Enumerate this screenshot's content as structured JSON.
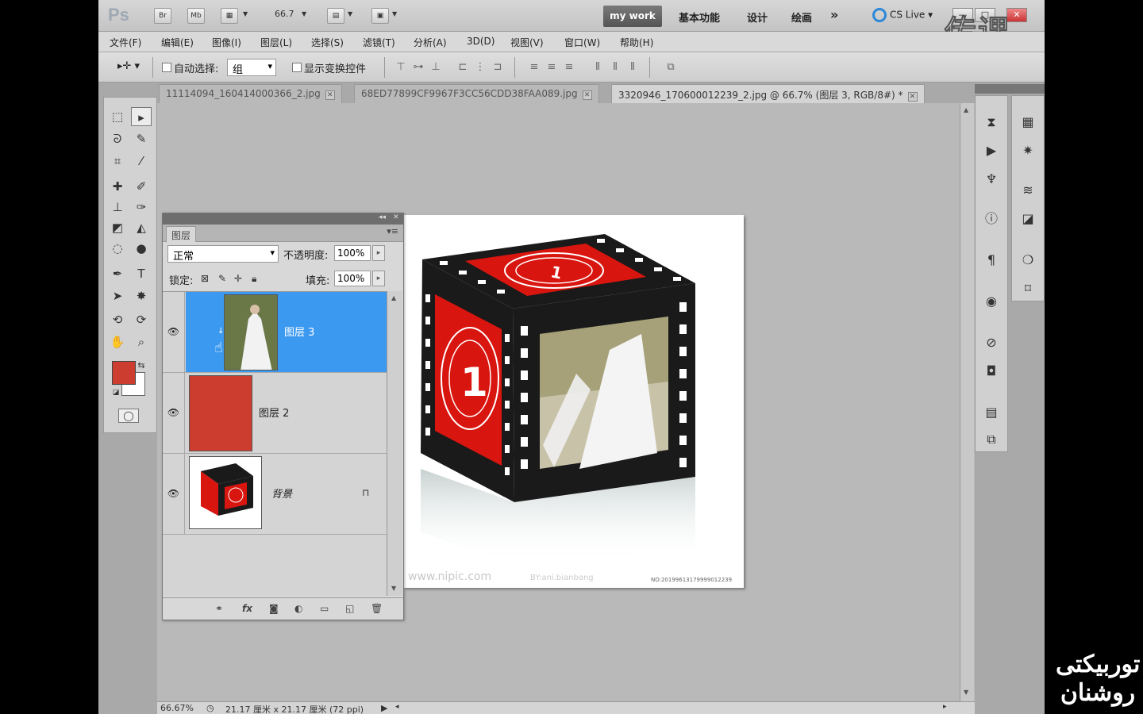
{
  "titlebar": {
    "app_logo": "Ps",
    "bridge_btn": "Br",
    "minibridge_btn": "Mb",
    "zoom_value": "66.7",
    "workspace_active": "my work",
    "workspaces": [
      "基本功能",
      "设计",
      "绘画"
    ],
    "more_label": "»",
    "cslive_label": "CS Live ▾",
    "watermark": "传课"
  },
  "menubar": {
    "items": [
      "文件(F)",
      "编辑(E)",
      "图像(I)",
      "图层(L)",
      "选择(S)",
      "滤镜(T)",
      "分析(A)",
      "3D(D)",
      "视图(V)",
      "窗口(W)",
      "帮助(H)"
    ]
  },
  "options": {
    "auto_select_label": "自动选择:",
    "auto_select_value": "组",
    "show_transform_label": "显示变换控件"
  },
  "tabs": [
    {
      "label": "11114094_160414000366_2.jpg",
      "active": false
    },
    {
      "label": "68ED77899CF9967F3CC56CDD38FAA089.jpg",
      "active": false
    },
    {
      "label": "3320946_170600012239_2.jpg @ 66.7% (图层 3, RGB/8#) *",
      "active": true
    }
  ],
  "layers_panel": {
    "tab_label": "图层",
    "blend_mode": "正常",
    "opacity_label": "不透明度:",
    "opacity_value": "100%",
    "lock_label": "锁定:",
    "fill_label": "填充:",
    "fill_value": "100%",
    "layers": [
      {
        "name": "图层 3",
        "selected": true,
        "visible": true
      },
      {
        "name": "图层 2",
        "selected": false,
        "visible": true
      },
      {
        "name": "背景",
        "selected": false,
        "visible": true,
        "locked": true
      }
    ]
  },
  "document": {
    "cube_number": "1",
    "site_watermark": "www.nipic.com",
    "author_text": "BY:ani.bianbang",
    "id_text": "NO:20199613179999012239"
  },
  "statusbar": {
    "zoom": "66.67%",
    "doc_size": "21.17 厘米 x 21.17 厘米 (72 ppi)"
  },
  "colors": {
    "foreground": "#cd3d2f",
    "background": "#ffffff",
    "selection": "#3c99f0"
  },
  "overlay": {
    "corner_watermark": "توربیکتی روشنان"
  }
}
